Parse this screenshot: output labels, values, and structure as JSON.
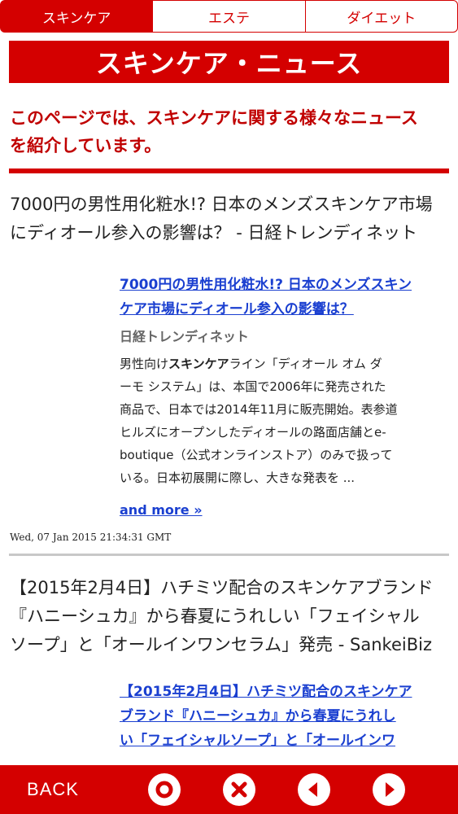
{
  "tabs": [
    {
      "label": "スキンケア",
      "active": true
    },
    {
      "label": "エステ",
      "active": false
    },
    {
      "label": "ダイエット",
      "active": false
    }
  ],
  "header": {
    "title": "スキンケア・ニュース",
    "intro_line1": "このページでは、スキンケアに関する様々なニュース",
    "intro_line2": "を紹介しています。"
  },
  "articles": [
    {
      "title_line1": "7000円の男性用化粧水!? 日本のメンズスキンケア市場",
      "title_line2": "にディオール参入の影響は？ - 日経トレンディネット",
      "link_line1": "7000円の男性用化粧水!? 日本のメンズスキン",
      "link_line2": "ケア市場にディオール参入の影響は？",
      "source": "日経トレンディネット",
      "snippet_l1_pre": "男性向け",
      "snippet_l1_bold": "スキンケア",
      "snippet_l1_post": "ライン「ディオール オム ダ",
      "snippet_l2": "ーモ システム」は、本国で2006年に発売された",
      "snippet_l3": "商品で、日本では2014年11月に販売開始。表参道",
      "snippet_l4": "ヒルズにオープンしたディオールの路面店舗とe-",
      "snippet_l5": "boutique（公式オンラインストア）のみで扱って",
      "snippet_l6": "いる。日本初展開に際し、大きな発表を ...",
      "more": "and more »",
      "date": "Wed, 07 Jan 2015 21:34:31 GMT"
    },
    {
      "title_line1": "【2015年2月4日】ハチミツ配合のスキンケアブランド",
      "title_line2": "『ハニーシュカ』から春夏にうれしい「フェイシャル",
      "title_line3": "ソープ」と「オールインワンセラム」発売 - SankeiBiz",
      "link_line1": "【2015年2月4日】ハチミツ配合のスキンケア",
      "link_line2": "ブランド『ハニーシュカ』から春夏にうれし",
      "link_line3": "い「フェイシャルソープ」と「オールインワ"
    }
  ],
  "bottom_bar": {
    "back_label": "BACK",
    "icons": [
      "home-circle-icon",
      "close-circle-icon",
      "prev-arrow-icon",
      "next-arrow-icon"
    ]
  },
  "colors": {
    "accent": "#d40000",
    "link": "#1a3fd0"
  }
}
